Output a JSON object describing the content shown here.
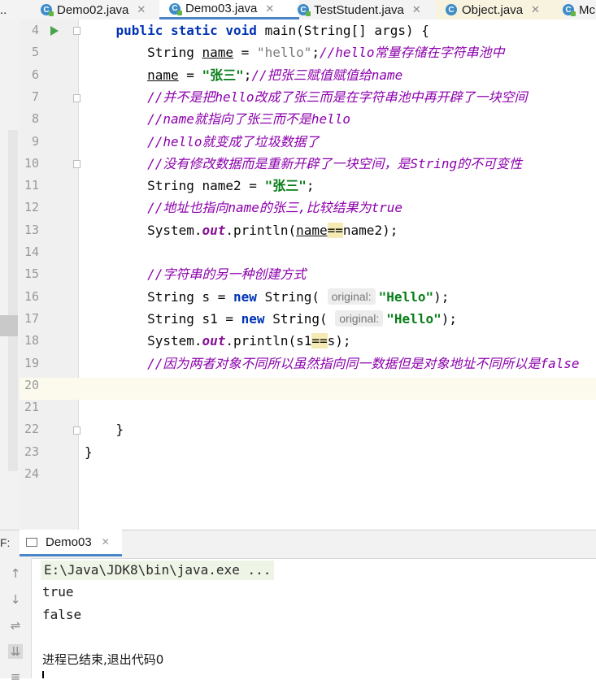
{
  "tabs": [
    {
      "label": "Demo02.java",
      "active": false
    },
    {
      "label": "Demo03.java",
      "active": true
    },
    {
      "label": "TestStudent.java",
      "active": false
    },
    {
      "label": "Object.java",
      "active": false
    },
    {
      "label": "Mc",
      "active": false
    }
  ],
  "tab_overflow": ".. ",
  "editor": {
    "line_numbers": [
      "4",
      "5",
      "6",
      "7",
      "8",
      "9",
      "10",
      "11",
      "12",
      "13",
      "14",
      "15",
      "16",
      "17",
      "18",
      "19",
      "20",
      "21",
      "22",
      "23",
      "24"
    ],
    "lines": [
      {
        "segments": [
          [
            "    ",
            ""
          ],
          [
            "public static void ",
            "kw"
          ],
          [
            "main(String[] args) {",
            ""
          ]
        ]
      },
      {
        "segments": [
          [
            "        String ",
            ""
          ],
          [
            "name",
            "ul"
          ],
          [
            " = ",
            ""
          ],
          [
            "\"hello\"",
            "gray"
          ],
          [
            ";",
            ""
          ],
          [
            "//hello常量存储在字符串池中",
            "cm"
          ]
        ]
      },
      {
        "segments": [
          [
            "        ",
            ""
          ],
          [
            "name",
            "ul"
          ],
          [
            " = ",
            ""
          ],
          [
            "\"张三\"",
            "str"
          ],
          [
            ";",
            ""
          ],
          [
            "//把张三赋值赋值给name",
            "cm"
          ]
        ]
      },
      {
        "segments": [
          [
            "        ",
            ""
          ],
          [
            "//并不是把hello改成了张三而是在字符串池中再开辟了一块空间",
            "cm"
          ]
        ]
      },
      {
        "segments": [
          [
            "        ",
            ""
          ],
          [
            "//name就指向了张三而不是hello",
            "cm"
          ]
        ]
      },
      {
        "segments": [
          [
            "        ",
            ""
          ],
          [
            "//hello就变成了垃圾数据了",
            "cm"
          ]
        ]
      },
      {
        "segments": [
          [
            "        ",
            ""
          ],
          [
            "//没有修改数据而是重新开辟了一块空间，是String的不可变性",
            "cm"
          ]
        ]
      },
      {
        "segments": [
          [
            "        String name2 = ",
            ""
          ],
          [
            "\"张三\"",
            "str"
          ],
          [
            ";",
            ""
          ]
        ]
      },
      {
        "segments": [
          [
            "        ",
            ""
          ],
          [
            "//地址也指向name的张三,比较结果为true",
            "cm"
          ]
        ]
      },
      {
        "segments": [
          [
            "        System.",
            ""
          ],
          [
            "out",
            "fld"
          ],
          [
            ".println(",
            ""
          ],
          [
            "name",
            "ul"
          ],
          [
            "==",
            "hl"
          ],
          [
            "name2);",
            ""
          ]
        ]
      },
      {
        "segments": [
          [
            "",
            ""
          ]
        ]
      },
      {
        "segments": [
          [
            "        ",
            ""
          ],
          [
            "//字符串的另一种创建方式",
            "cm"
          ]
        ]
      },
      {
        "segments": [
          [
            "        String s = ",
            ""
          ],
          [
            "new ",
            "kw"
          ],
          [
            "String( ",
            ""
          ],
          [
            "original:",
            "hint"
          ],
          [
            "\"Hello\"",
            "str"
          ],
          [
            ");",
            ""
          ]
        ]
      },
      {
        "segments": [
          [
            "        String s1 = ",
            ""
          ],
          [
            "new ",
            "kw"
          ],
          [
            "String( ",
            ""
          ],
          [
            "original:",
            "hint"
          ],
          [
            "\"Hello\"",
            "str"
          ],
          [
            ");",
            ""
          ]
        ]
      },
      {
        "segments": [
          [
            "        System.",
            ""
          ],
          [
            "out",
            "fld"
          ],
          [
            ".println(s1",
            ""
          ],
          [
            "==",
            "hl"
          ],
          [
            "s);",
            ""
          ]
        ]
      },
      {
        "segments": [
          [
            "        ",
            ""
          ],
          [
            "//因为两者对象不同所以虽然指向同一数据但是对象地址不同所以是false",
            "cm"
          ]
        ]
      },
      {
        "segments": [
          [
            "",
            ""
          ]
        ]
      },
      {
        "segments": [
          [
            "",
            ""
          ]
        ]
      },
      {
        "segments": [
          [
            "    }",
            ""
          ]
        ]
      },
      {
        "segments": [
          [
            "}",
            ""
          ]
        ]
      },
      {
        "segments": [
          [
            "",
            ""
          ]
        ]
      }
    ]
  },
  "run_panel": {
    "side_label": "F:",
    "tab_label": "Demo03",
    "command": "E:\\Java\\JDK8\\bin\\java.exe ...",
    "output": [
      "true",
      "false",
      "",
      "进程已结束,退出代码0"
    ]
  },
  "colors": {
    "keyword": "#0033b3",
    "string": "#067d17",
    "comment": "#8c00ac",
    "current_line": "#fcfaed",
    "tab_underline": "#4a86c8"
  }
}
